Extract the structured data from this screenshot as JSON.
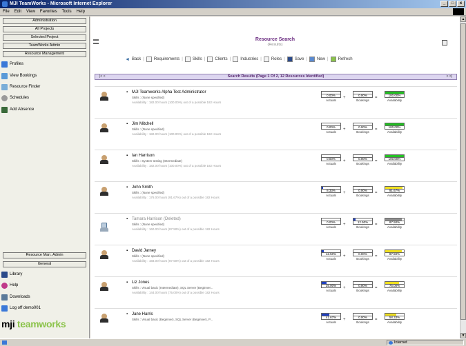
{
  "window": {
    "title": "MJI TeamWorks - Microsoft Internet Explorer",
    "min": "_",
    "max": "□",
    "close": "x"
  },
  "menu": [
    "File",
    "Edit",
    "View",
    "Favorites",
    "Tools",
    "Help"
  ],
  "sidebar": {
    "top_buttons": [
      "Administration",
      "All Projects",
      "Selected Project",
      "TeamWorks Admin",
      "Resource Management"
    ],
    "links": [
      {
        "label": "Profiles",
        "icon": "profiles-icon",
        "color": "#3a78d8"
      },
      {
        "label": "View Bookings",
        "icon": "bookings-icon",
        "color": "#5a9ad8"
      },
      {
        "label": "Resource Finder",
        "icon": "finder-icon",
        "color": "#7aaed8"
      },
      {
        "label": "Schedules",
        "icon": "schedules-icon",
        "color": "#9a9a9a"
      },
      {
        "label": "Add Absence",
        "icon": "absence-icon",
        "color": "#3a6a3a"
      }
    ],
    "bottom_buttons": [
      "Resource Man. Admin",
      "General"
    ],
    "bottom_links": [
      {
        "label": "Library",
        "icon": "library-icon",
        "color": "#2b4a8a"
      },
      {
        "label": "Help",
        "icon": "help-icon",
        "color": "#c03a8a"
      },
      {
        "label": "Downloads",
        "icon": "downloads-icon",
        "color": "#5a7a9a"
      },
      {
        "label": "Log off demo001",
        "icon": "logoff-icon",
        "color": "#3a78d8"
      }
    ],
    "logo_main": "mji",
    "logo_accent": "teamworks"
  },
  "main": {
    "title": "Resource Search",
    "subtitle": "(Results)",
    "toolbar": {
      "back": "Back",
      "items": [
        "Requirements",
        "Skills",
        "Clients",
        "Industries",
        "Roles",
        "Save",
        "New",
        "Refresh"
      ]
    },
    "results": {
      "title": "Search Results (Page 1 Of 2, 12 Resources Identified)",
      "prev": "|< <",
      "next": "> >|"
    },
    "people": [
      {
        "name": "MJI Teamworks Alpha Test Administrator",
        "skills": "Skills : (None specified)",
        "availability": "Availability : 182.00 hours (100.00%) out of a possible 182 Hours",
        "actuals": "0.00%",
        "bookings": "0.00%",
        "avail": "100.00%",
        "actuals_v": 0,
        "bookings_v": 0,
        "avail_v": 100,
        "avail_color": "#22c022",
        "deleted": false
      },
      {
        "name": "Jim Mitchell",
        "skills": "Skills : (None specified)",
        "availability": "Availability : 182.00 hours (100.00%) out of a possible 182 Hours",
        "actuals": "0.00%",
        "bookings": "0.00%",
        "avail": "100.00%",
        "actuals_v": 0,
        "bookings_v": 0,
        "avail_v": 100,
        "avail_color": "#22c022",
        "deleted": false
      },
      {
        "name": "Ian Harrison",
        "skills": "Skills : System testing (Intermediate)",
        "availability": "Availability : 182.00 hours (100.00%) out of a possible 182 Hours",
        "actuals": "0.00%",
        "bookings": "0.00%",
        "avail": "100.00%",
        "actuals_v": 0,
        "bookings_v": 0,
        "avail_v": 100,
        "avail_color": "#22c022",
        "deleted": false
      },
      {
        "name": "John Smith",
        "skills": "Skills : (None specified)",
        "availability": "Availability : 176.00 hours (91.67%) out of a possible 182 Hours",
        "actuals": "8.33%",
        "bookings": "0.00%",
        "avail": "91.67%",
        "actuals_v": 8.33,
        "bookings_v": 0,
        "avail_v": 91.67,
        "avail_color": "#f0e020",
        "deleted": false
      },
      {
        "name": "Tamara Harrison (Deleted)",
        "skills": "Skills : (None specified)",
        "availability": "Availability : 160.00 hours (87.50%) out of a possible 182 Hours",
        "actuals": "0.00%",
        "bookings": "12.50%",
        "avail": "87.50%",
        "actuals_v": 0,
        "bookings_v": 12.5,
        "avail_v": 87.5,
        "avail_color": "#909090",
        "deleted": true
      },
      {
        "name": "David Jarney",
        "skills": "Skills : (None specified)",
        "availability": "Availability : 168.00 hours (87.50%) out of a possible 182 Hours",
        "actuals": "12.50%",
        "bookings": "0.00%",
        "avail": "87.50%",
        "actuals_v": 12.5,
        "bookings_v": 0,
        "avail_v": 87.5,
        "avail_color": "#f0e020",
        "deleted": false
      },
      {
        "name": "Liz Jones",
        "skills": "Skills : Visual basic (Intermediate), SQL Server (Beginner...",
        "availability": "Availability : 144.00 hours (75.00%) out of a possible 182 Hours",
        "actuals": "25.00%",
        "bookings": "0.00%",
        "avail": "75.00%",
        "actuals_v": 25,
        "bookings_v": 0,
        "avail_v": 75,
        "avail_color": "#f0e020",
        "deleted": false
      },
      {
        "name": "Jane Harris",
        "skills": "Skills : Visual basic (Beginner), SQL Server (Beginner), P...",
        "availability": "",
        "actuals": "41.67%",
        "bookings": "0.00%",
        "avail": "58.33%",
        "actuals_v": 41.67,
        "bookings_v": 0,
        "avail_v": 58.33,
        "avail_color": "#f0e020",
        "deleted": false
      }
    ],
    "labels": {
      "actuals": "Actuals",
      "bookings": "Bookings",
      "availability": "Availability",
      "plus": "+",
      "equals": "="
    }
  },
  "statusbar": {
    "zone": "Internet"
  }
}
